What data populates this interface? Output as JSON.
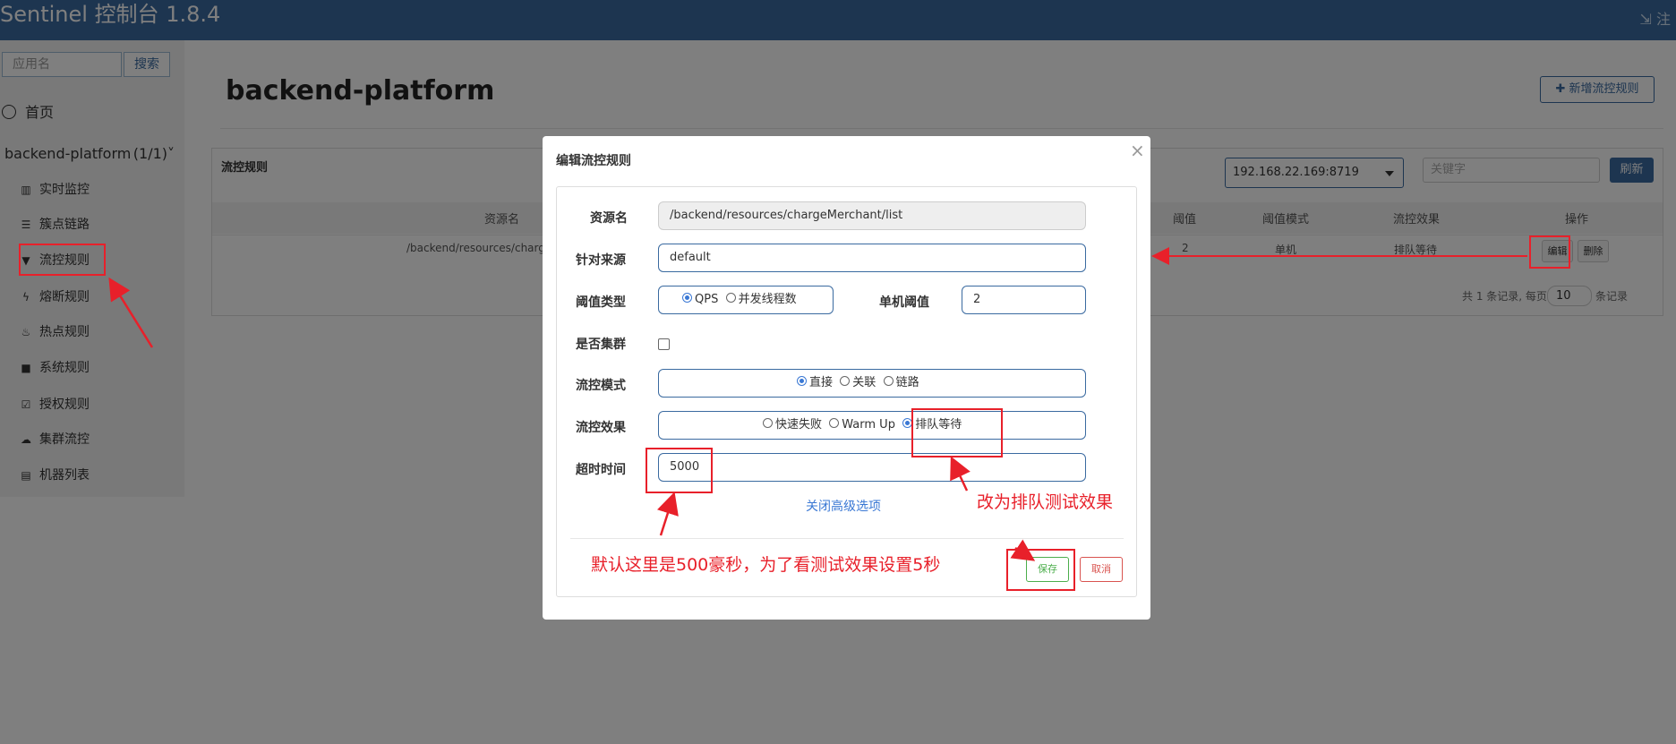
{
  "header": {
    "brand": "Sentinel 控制台 1.8.4",
    "logout_label": "注"
  },
  "sidebar": {
    "search_placeholder": "应用名",
    "search_button": "搜索",
    "home_label": "首页",
    "app_name": "backend-platform",
    "app_count": "(1/1)",
    "items": [
      {
        "label": "实时监控",
        "icon": "bar-chart-icon"
      },
      {
        "label": "簇点链路",
        "icon": "list-icon"
      },
      {
        "label": "流控规则",
        "icon": "filter-icon"
      },
      {
        "label": "熔断规则",
        "icon": "flash-icon"
      },
      {
        "label": "热点规则",
        "icon": "fire-icon"
      },
      {
        "label": "系统规则",
        "icon": "lock-icon"
      },
      {
        "label": "授权规则",
        "icon": "check-square-icon"
      },
      {
        "label": "集群流控",
        "icon": "cloud-icon"
      },
      {
        "label": "机器列表",
        "icon": "th-list-icon"
      }
    ]
  },
  "main": {
    "page_title": "backend-platform",
    "add_rule_button": "✚ 新增流控规则",
    "panel_title": "流控规则",
    "machine_select": "192.168.22.169:8719",
    "keyword_placeholder": "关键字",
    "refresh_button": "刷新",
    "table": {
      "headers": [
        "资源名",
        "阈值",
        "阈值模式",
        "流控效果",
        "操作"
      ],
      "rows": [
        {
          "resource": "/backend/resources/chargeM",
          "threshold": "2",
          "mode": "单机",
          "effect": "排队等待",
          "edit": "编辑",
          "delete": "删除"
        }
      ]
    },
    "pager": {
      "prefix": "共 1 条记录, 每页",
      "page_size": "10",
      "suffix": "条记录"
    }
  },
  "modal": {
    "title": "编辑流控规则",
    "close": "×",
    "fields": {
      "resource": {
        "label": "资源名",
        "value": "/backend/resources/chargeMerchant/list"
      },
      "limit_app": {
        "label": "针对来源",
        "value": "default"
      },
      "grade": {
        "label": "阈值类型",
        "options": [
          "QPS",
          "并发线程数"
        ],
        "selected": "QPS"
      },
      "count": {
        "label": "单机阈值",
        "value": "2"
      },
      "cluster": {
        "label": "是否集群",
        "checked": false
      },
      "strategy": {
        "label": "流控模式",
        "options": [
          "直接",
          "关联",
          "链路"
        ],
        "selected": "直接"
      },
      "control_behavior": {
        "label": "流控效果",
        "options": [
          "快速失败",
          "Warm Up",
          "排队等待"
        ],
        "selected": "排队等待"
      },
      "timeout": {
        "label": "超时时间",
        "value": "5000"
      }
    },
    "advanced_link": "关闭高级选项",
    "save_button": "保存",
    "cancel_button": "取消"
  },
  "annotations": {
    "effect_note": "改为排队测试效果",
    "timeout_note": "默认这里是500豪秒，为了看测试效果设置5秒",
    "color": "#e8202a"
  }
}
